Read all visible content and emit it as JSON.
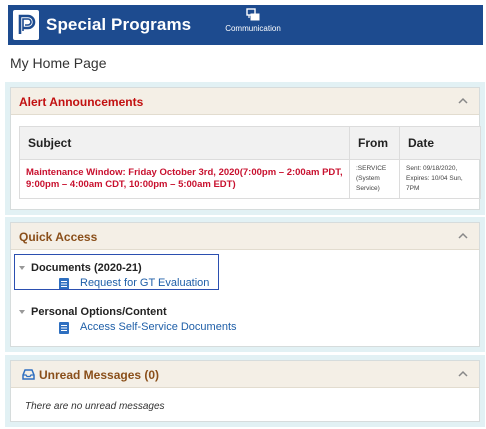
{
  "header": {
    "app_title": "Special Programs",
    "nav_item": "Communication",
    "brand_color": "#1d4b8f"
  },
  "page": {
    "title": "My Home Page"
  },
  "alerts": {
    "title": "Alert Announcements",
    "columns": [
      "Subject",
      "From",
      "Date"
    ],
    "rows": [
      {
        "subject": "Maintenance Window: Friday October 3rd, 2020(7:00pm – 2:00am PDT, 9:00pm – 4:00am CDT, 10:00pm – 5:00am EDT)",
        "from_lines": [
          ":SERVICE",
          "(System",
          "Service)"
        ],
        "date_lines": [
          "Sent: 09/18/2020,",
          "Expires: 10/04 Sun, 7PM"
        ]
      }
    ]
  },
  "quick_access": {
    "title": "Quick Access",
    "groups": [
      {
        "title": "Documents (2020-21)",
        "link": "Request for GT Evaluation"
      },
      {
        "title": "Personal Options/Content",
        "link": "Access Self-Service Documents"
      }
    ]
  },
  "messages": {
    "title": "Unread Messages (0)",
    "empty_text": "There are no unread messages"
  }
}
